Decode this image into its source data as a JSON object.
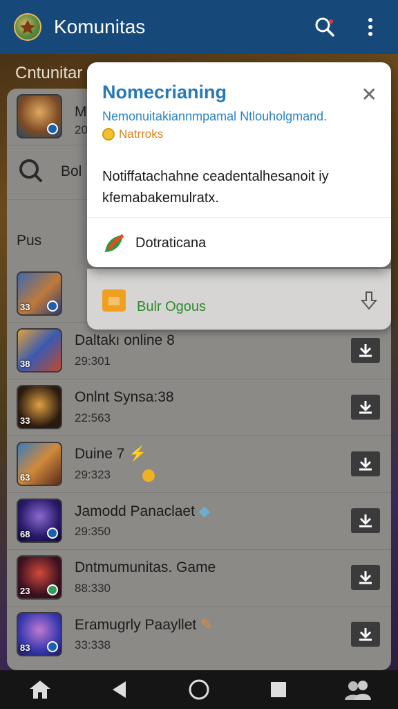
{
  "appbar": {
    "title": "Komunitas",
    "logo": "app-logo",
    "search_icon": "search-icon",
    "menu_icon": "more-vert-icon"
  },
  "background": {
    "heading": "Cntunitar"
  },
  "panel": {
    "peek_row": {
      "title": "M",
      "sub": "20"
    },
    "search_row": {
      "text": "Bol"
    },
    "section_label": "Pus",
    "rows": [
      {
        "title": "",
        "sub": "",
        "badge": "33"
      },
      {
        "title": "Daltakı online 8",
        "sub": "29:301",
        "badge": "38"
      },
      {
        "title": "Onlnt Synsa:38",
        "sub": "22:563",
        "badge": "33"
      },
      {
        "title": "Duine 7",
        "sub": "29:323",
        "badge": "63"
      },
      {
        "title": "Jamodd Panaclaet",
        "sub": "29:350",
        "badge": "68"
      },
      {
        "title": "Dntmumunitas. Game",
        "sub": "88:330",
        "badge": "23"
      },
      {
        "title": "Eramugrly Paayllet",
        "sub": "33:338",
        "badge": "83"
      }
    ]
  },
  "popup": {
    "title": "Nomecrianing",
    "subtitle": "Nemonuitakiannmpamal Ntlouholgmand.",
    "tag": "Natrroks",
    "body": "Notiffatachahne ceadentalhesanoit iy kfemabakemulratx.",
    "action": "Dotraticana",
    "close_icon": "close-icon"
  },
  "sheet2": {
    "text": "Bulr Ogous"
  },
  "navbar": {
    "items": [
      "home-icon",
      "back-icon",
      "home-circle-icon",
      "recents-icon",
      "people-icon"
    ]
  },
  "colors": {
    "appbar": "#17487a",
    "popup_title": "#2679b8",
    "accent_green": "#2f8a2f",
    "tag_orange": "#d9821a"
  }
}
